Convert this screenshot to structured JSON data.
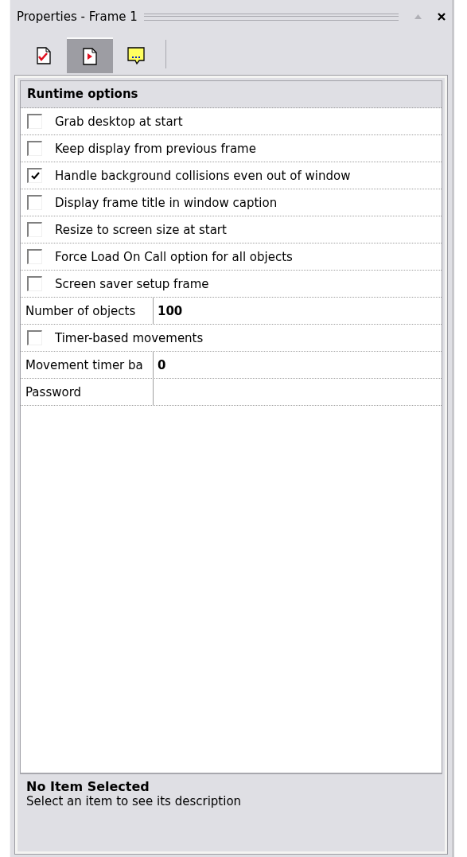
{
  "window": {
    "title": "Properties - Frame 1"
  },
  "toolbar": [
    {
      "kind": "check-page",
      "selected": false
    },
    {
      "kind": "play-page",
      "selected": true
    },
    {
      "kind": "note",
      "selected": false
    }
  ],
  "grid": {
    "section": "Runtime options",
    "rows": [
      {
        "kind": "checkbox",
        "label": "Grab desktop at start",
        "checked": false
      },
      {
        "kind": "checkbox",
        "label": "Keep display from previous frame",
        "checked": false
      },
      {
        "kind": "checkbox",
        "label": "Handle background collisions even out of window",
        "checked": true
      },
      {
        "kind": "checkbox",
        "label": "Display frame title in window caption",
        "checked": false
      },
      {
        "kind": "checkbox",
        "label": "Resize to screen size at start",
        "checked": false
      },
      {
        "kind": "checkbox",
        "label": "Force Load On Call option for all objects",
        "checked": false
      },
      {
        "kind": "checkbox",
        "label": "Screen saver setup frame",
        "checked": false
      },
      {
        "kind": "value",
        "label": "Number of objects",
        "value": "100"
      },
      {
        "kind": "checkbox",
        "label": "Timer-based movements",
        "checked": false
      },
      {
        "kind": "value",
        "label": "Movement timer ba",
        "value": "0"
      },
      {
        "kind": "value",
        "label": "Password"
      }
    ]
  },
  "description": {
    "title": "No Item Selected",
    "text": "Select an item to see its description"
  }
}
